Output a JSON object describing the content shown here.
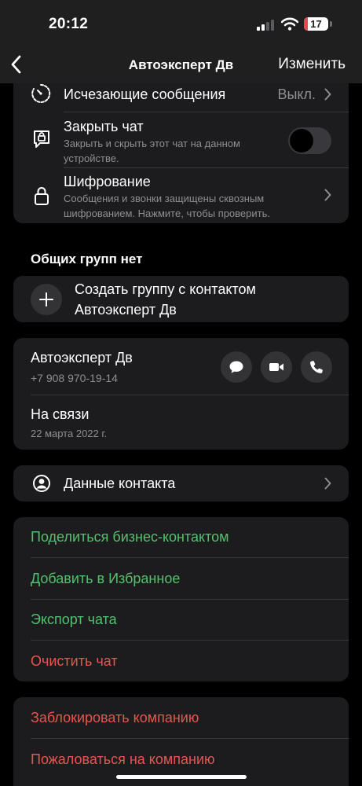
{
  "status_bar": {
    "time": "20:12",
    "battery": "17"
  },
  "nav": {
    "title": "Автоэксперт Дв",
    "edit_label": "Изменить"
  },
  "settings": {
    "disappearing": {
      "label": "Исчезающие сообщения",
      "value": "Выкл."
    },
    "lock_chat": {
      "label": "Закрыть чат",
      "subtitle_1": "Закрыть и скрыть этот чат на данном",
      "subtitle_2": "устройстве.",
      "enabled": false
    },
    "encryption": {
      "label": "Шифрование",
      "subtitle_1": "Сообщения и звонки защищены сквозным",
      "subtitle_2": "шифрованием. Нажмите, чтобы проверить."
    }
  },
  "groups": {
    "header": "Общих групп нет",
    "create_line_1": "Создать группу с контактом",
    "create_line_2": "Автоэксперт Дв"
  },
  "contact": {
    "name": "Автоэксперт Дв",
    "phone": "+7 908 970-19-14",
    "status_label": "На связи",
    "status_date": "22 марта 2022 г."
  },
  "contact_info": {
    "label": "Данные контакта"
  },
  "actions": {
    "share": "Поделиться бизнес-контактом",
    "favorite": "Добавить в Избранное",
    "export": "Экспорт чата",
    "clear": "Очистить чат"
  },
  "danger": {
    "block": "Заблокировать компанию",
    "report": "Пожаловаться на компанию"
  },
  "colors": {
    "accent_green": "#54c06f",
    "destructive_red": "#e5564f",
    "card_bg": "#1c1c1e"
  }
}
